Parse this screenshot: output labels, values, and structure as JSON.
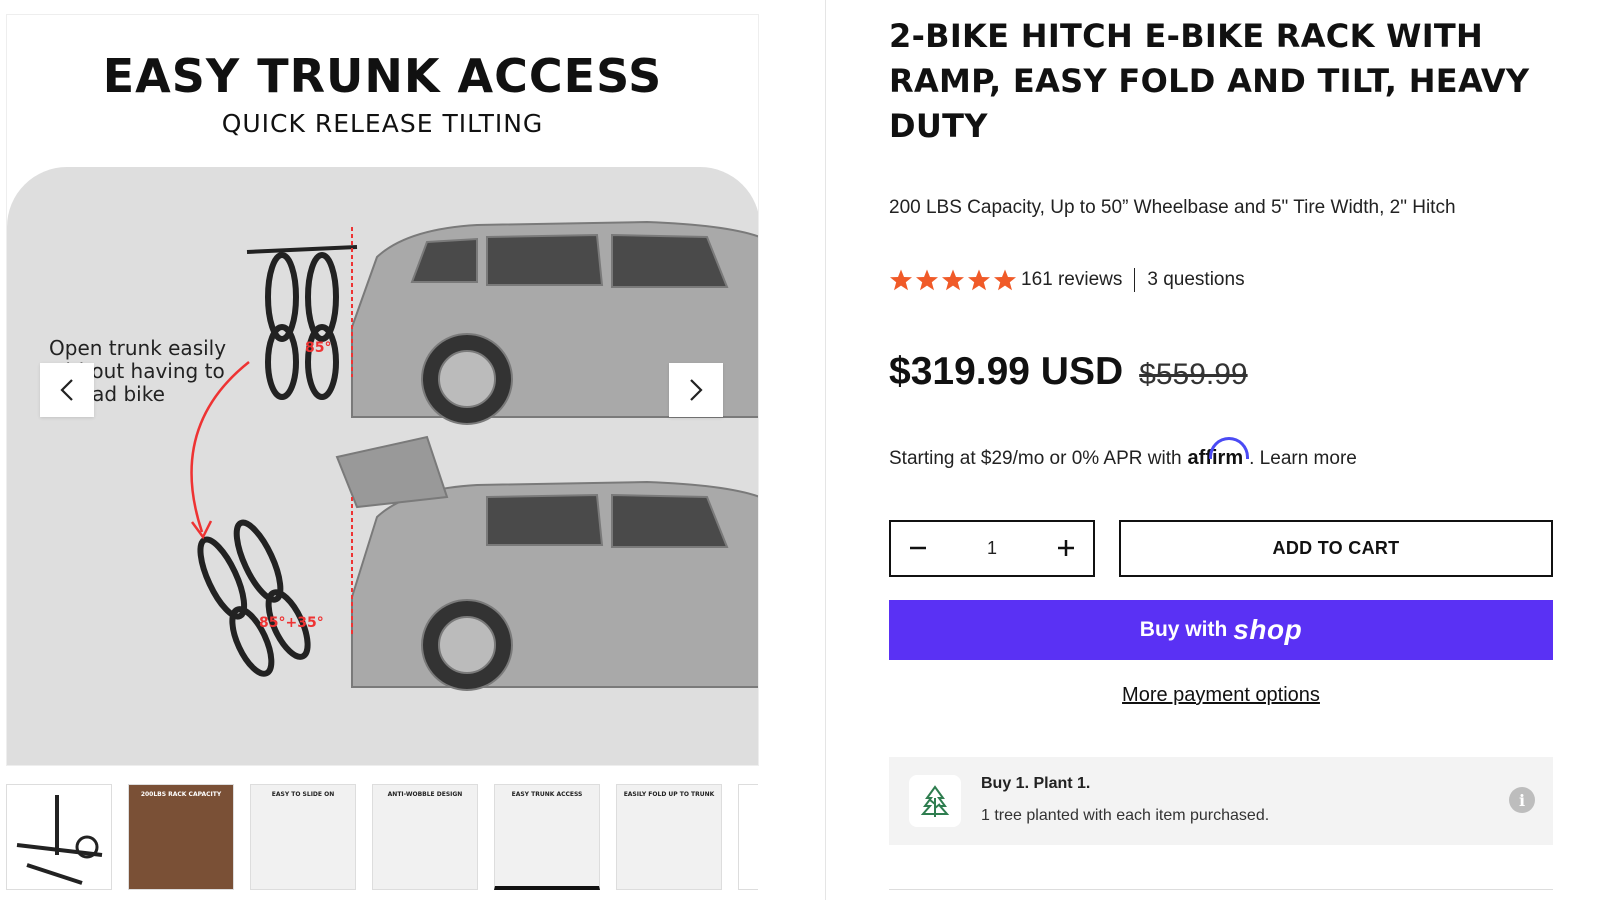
{
  "gallery": {
    "image_heading": "EASY TRUNK ACCESS",
    "image_subheading": "QUICK RELEASE TILTING",
    "callout": "Open trunk easily without having to unload bike",
    "angle_label_top": "85°",
    "angle_label_bottom": "85°+35°",
    "prev_icon": "chevron-left-icon",
    "next_icon": "chevron-right-icon",
    "thumbnails": [
      {
        "label": ""
      },
      {
        "label": "200LBS RACK CAPACITY"
      },
      {
        "label": "EASY TO SLIDE ON"
      },
      {
        "label": "ANTI-WOBBLE DESIGN"
      },
      {
        "label": "EASY TRUNK ACCESS"
      },
      {
        "label": "EASILY FOLD UP TO TRUNK"
      },
      {
        "label": ""
      }
    ]
  },
  "product": {
    "title": "2-BIKE HITCH E-BIKE RACK WITH RAMP, EASY FOLD AND TILT, HEAVY DUTY",
    "subtitle": "200 LBS Capacity, Up to 50” Wheelbase and 5\" Tire Width, 2\" Hitch",
    "rating_stars": 5,
    "reviews": "161 reviews",
    "questions": "3 questions",
    "price": "$319.99 USD",
    "compare_price": "$559.99",
    "affirm_prefix": "Starting at $29/mo or 0% APR with",
    "affirm_brand": "affirm",
    "affirm_learn": ". Learn more",
    "quantity": "1",
    "add_to_cart": "ADD TO CART",
    "buy_with": "Buy with",
    "shop_brand": "shop",
    "more_payment": "More payment options",
    "plant_title": "Buy 1. Plant 1.",
    "plant_desc": "1 tree planted with each item purchased."
  },
  "colors": {
    "star": "#f05a28",
    "shop_button": "#5a31f4",
    "affirm_arc": "#4a4af4",
    "plant_bg": "#f3f3f3"
  }
}
